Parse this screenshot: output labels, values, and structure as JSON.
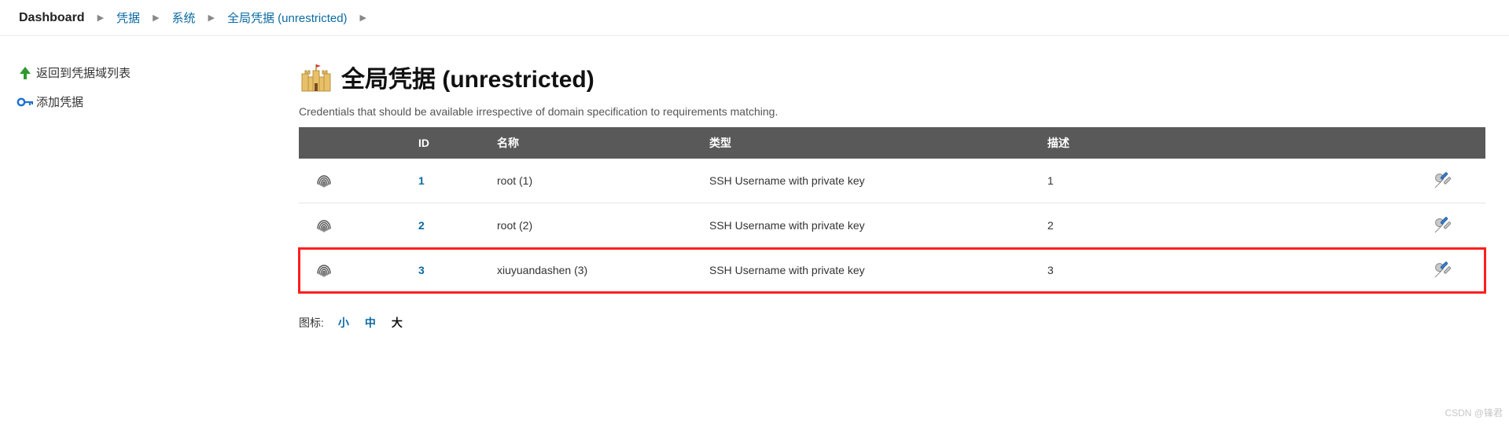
{
  "breadcrumb": {
    "items": [
      {
        "label": "Dashboard"
      },
      {
        "label": "凭据"
      },
      {
        "label": "系统"
      },
      {
        "label": "全局凭据 (unrestricted)"
      }
    ]
  },
  "sidebar": {
    "items": [
      {
        "icon": "arrow-up-green",
        "label": "返回到凭据域列表"
      },
      {
        "icon": "key-blue",
        "label": "添加凭据"
      }
    ]
  },
  "page": {
    "title": "全局凭据 (unrestricted)",
    "desc": "Credentials that should be available irrespective of domain specification to requirements matching."
  },
  "table": {
    "headers": {
      "icon": "",
      "id": "ID",
      "name": "名称",
      "type": "类型",
      "desc": "描述",
      "act": ""
    },
    "rows": [
      {
        "id": "1",
        "name": "root (1)",
        "type": "SSH Username with private key",
        "desc": "1",
        "highlight": false
      },
      {
        "id": "2",
        "name": "root (2)",
        "type": "SSH Username with private key",
        "desc": "2",
        "highlight": false
      },
      {
        "id": "3",
        "name": "xiuyuandashen (3)",
        "type": "SSH Username with private key",
        "desc": "3",
        "highlight": true
      }
    ]
  },
  "icon_size": {
    "label": "图标:",
    "options": [
      "小",
      "中",
      "大"
    ],
    "selected": "大"
  },
  "watermark": "CSDN @锋君"
}
